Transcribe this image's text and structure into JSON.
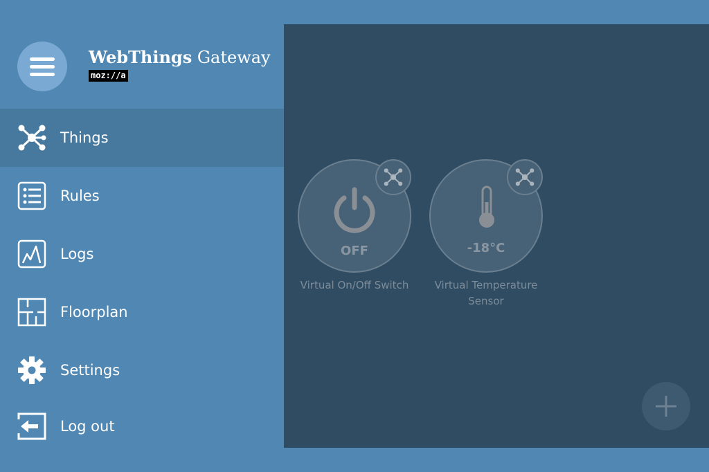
{
  "brand": {
    "title_bold": "WebThings",
    "title_light": "Gateway",
    "logo_text": "moz://a"
  },
  "nav": {
    "items": [
      {
        "label": "Things",
        "icon": "things-icon",
        "active": true
      },
      {
        "label": "Rules",
        "icon": "rules-icon"
      },
      {
        "label": "Logs",
        "icon": "logs-icon"
      },
      {
        "label": "Floorplan",
        "icon": "floorplan-icon"
      },
      {
        "label": "Settings",
        "icon": "gear-icon"
      },
      {
        "label": "Log out",
        "icon": "logout-icon"
      }
    ]
  },
  "things": [
    {
      "name": "Virtual On/Off Switch",
      "value": "OFF",
      "icon": "power-icon"
    },
    {
      "name": "Virtual Temperature Sensor",
      "value": "-18°C",
      "icon": "thermometer-icon"
    }
  ],
  "colors": {
    "sidebar": "#5088b3",
    "active_item": "#47799f",
    "main_panel": "#2f4c63",
    "thing_bg": "#476176"
  }
}
